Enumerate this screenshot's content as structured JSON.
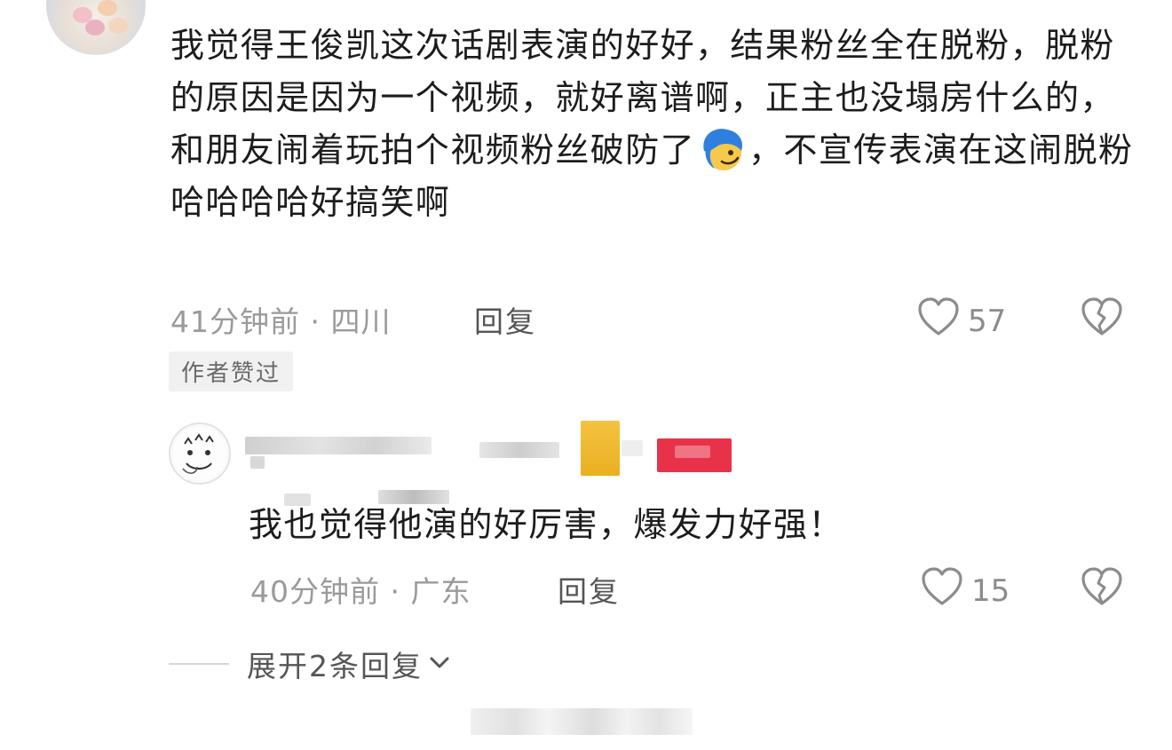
{
  "comment": {
    "text_before_emoji": "我觉得王俊凯这次话剧表演的好好，结果粉丝全在脱粉，脱粉的原因是因为一个视频，就好离谱啊，正主也没塌房什么的，和朋友闹着玩拍个视频粉丝破防了",
    "emoji_icon": "smirk-emoji-icon",
    "text_after_emoji": "，不宣传表演在这闹脱粉哈哈哈哈好搞笑啊",
    "time_location": "41分钟前 · 四川",
    "reply_label": "回复",
    "like_count": "57",
    "author_badge": "作者赞过"
  },
  "reply": {
    "text": "我也觉得他演的好厉害，爆发力好强！",
    "time_location": "40分钟前 · 广东",
    "reply_label": "回复",
    "like_count": "15"
  },
  "expand_replies": {
    "label": "展开2条回复"
  },
  "colors": {
    "text": "#1c1c1c",
    "meta": "#9a9a9a",
    "badge_bg": "#f1f1f1"
  }
}
